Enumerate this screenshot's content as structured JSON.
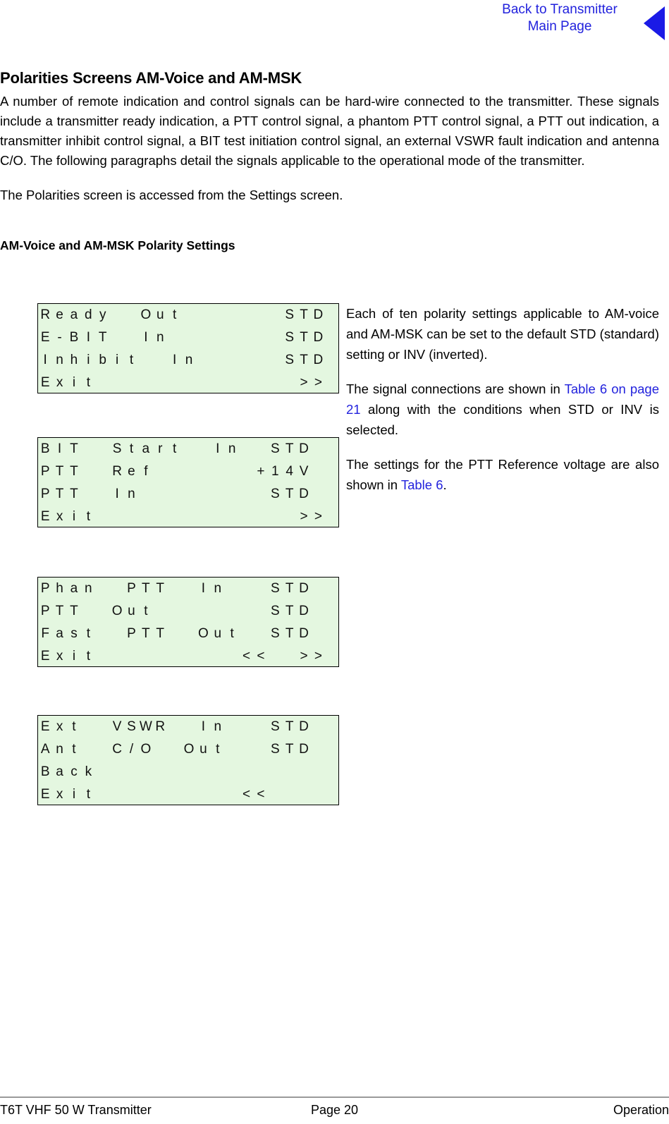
{
  "header": {
    "back_link_line1": "Back to Transmitter",
    "back_link_line2": "Main Page",
    "triangle_icon": "left-triangle-icon",
    "triangle_color": "#1a1ae6",
    "link_color": "#2222dd"
  },
  "section": {
    "title": "Polarities Screens AM-Voice and AM-MSK",
    "paragraph_1": "A number of remote indication and control signals can be hard-wire connected to the transmitter. These signals include a transmitter ready indication, a PTT control signal, a phantom PTT control signal, a PTT out indication, a transmitter inhibit control signal, a BIT test initiation control signal, an external VSWR fault indication and antenna C/O. The following paragraphs detail the signals applicable to the operational mode of the transmitter.",
    "paragraph_2": "The Polarities screen is accessed from the Settings screen.",
    "subtitle": "AM-Voice and AM-MSK Polarity Settings"
  },
  "lcd_screens": [
    {
      "name": "polarity-screen-1",
      "columns": 21,
      "background": "#e4f7e0",
      "rows": [
        {
          "cells": [
            {
              "col": 0,
              "ch": "R"
            },
            {
              "col": 1,
              "ch": "e"
            },
            {
              "col": 2,
              "ch": "a"
            },
            {
              "col": 3,
              "ch": "d"
            },
            {
              "col": 4,
              "ch": "y"
            },
            {
              "col": 7,
              "ch": "O"
            },
            {
              "col": 8,
              "ch": "u"
            },
            {
              "col": 9,
              "ch": "t"
            },
            {
              "col": 17,
              "ch": "S"
            },
            {
              "col": 18,
              "ch": "T"
            },
            {
              "col": 19,
              "ch": "D"
            }
          ],
          "text": "Ready   Out        STD"
        },
        {
          "cells": [
            {
              "col": 0,
              "ch": "E"
            },
            {
              "col": 1,
              "ch": "-"
            },
            {
              "col": 2,
              "ch": "B"
            },
            {
              "col": 3,
              "ch": "I"
            },
            {
              "col": 4,
              "ch": "T"
            },
            {
              "col": 7,
              "ch": "I"
            },
            {
              "col": 8,
              "ch": "n"
            },
            {
              "col": 17,
              "ch": "S"
            },
            {
              "col": 18,
              "ch": "T"
            },
            {
              "col": 19,
              "ch": "D"
            }
          ],
          "text": "E-BIT   In         STD"
        },
        {
          "cells": [
            {
              "col": 0,
              "ch": "I"
            },
            {
              "col": 1,
              "ch": "n"
            },
            {
              "col": 2,
              "ch": "h"
            },
            {
              "col": 3,
              "ch": "i"
            },
            {
              "col": 4,
              "ch": "b"
            },
            {
              "col": 5,
              "ch": "i"
            },
            {
              "col": 6,
              "ch": "t"
            },
            {
              "col": 9,
              "ch": "I"
            },
            {
              "col": 10,
              "ch": "n"
            },
            {
              "col": 17,
              "ch": "S"
            },
            {
              "col": 18,
              "ch": "T"
            },
            {
              "col": 19,
              "ch": "D"
            }
          ],
          "text": "Inhibit  In        STD"
        },
        {
          "cells": [
            {
              "col": 0,
              "ch": "E"
            },
            {
              "col": 1,
              "ch": "x"
            },
            {
              "col": 2,
              "ch": "i"
            },
            {
              "col": 3,
              "ch": "t"
            },
            {
              "col": 18,
              "ch": ">"
            },
            {
              "col": 19,
              "ch": ">"
            }
          ],
          "text": "Exit                >>"
        }
      ]
    },
    {
      "name": "polarity-screen-2",
      "columns": 21,
      "background": "#e4f7e0",
      "rows": [
        {
          "cells": [
            {
              "col": 0,
              "ch": "B"
            },
            {
              "col": 1,
              "ch": "I"
            },
            {
              "col": 2,
              "ch": "T"
            },
            {
              "col": 5,
              "ch": "S"
            },
            {
              "col": 6,
              "ch": "t"
            },
            {
              "col": 7,
              "ch": "a"
            },
            {
              "col": 8,
              "ch": "r"
            },
            {
              "col": 9,
              "ch": "t"
            },
            {
              "col": 12,
              "ch": "I"
            },
            {
              "col": 13,
              "ch": "n"
            },
            {
              "col": 16,
              "ch": "S"
            },
            {
              "col": 17,
              "ch": "T"
            },
            {
              "col": 18,
              "ch": "D"
            }
          ],
          "text": "BIT  Start  In  STD"
        },
        {
          "cells": [
            {
              "col": 0,
              "ch": "P"
            },
            {
              "col": 1,
              "ch": "T"
            },
            {
              "col": 2,
              "ch": "T"
            },
            {
              "col": 5,
              "ch": "R"
            },
            {
              "col": 6,
              "ch": "e"
            },
            {
              "col": 7,
              "ch": "f"
            },
            {
              "col": 15,
              "ch": "+"
            },
            {
              "col": 16,
              "ch": "1"
            },
            {
              "col": 17,
              "ch": "4"
            },
            {
              "col": 18,
              "ch": "V"
            }
          ],
          "text": "PTT  Ref        +14V"
        },
        {
          "cells": [
            {
              "col": 0,
              "ch": "P"
            },
            {
              "col": 1,
              "ch": "T"
            },
            {
              "col": 2,
              "ch": "T"
            },
            {
              "col": 5,
              "ch": "I"
            },
            {
              "col": 6,
              "ch": "n"
            },
            {
              "col": 16,
              "ch": "S"
            },
            {
              "col": 17,
              "ch": "T"
            },
            {
              "col": 18,
              "ch": "D"
            }
          ],
          "text": "PTT  In         STD"
        },
        {
          "cells": [
            {
              "col": 0,
              "ch": "E"
            },
            {
              "col": 1,
              "ch": "x"
            },
            {
              "col": 2,
              "ch": "i"
            },
            {
              "col": 3,
              "ch": "t"
            },
            {
              "col": 18,
              "ch": ">"
            },
            {
              "col": 19,
              "ch": ">"
            }
          ],
          "text": "Exit                >>"
        }
      ]
    },
    {
      "name": "polarity-screen-3",
      "columns": 21,
      "background": "#e4f7e0",
      "rows": [
        {
          "cells": [
            {
              "col": 0,
              "ch": "P"
            },
            {
              "col": 1,
              "ch": "h"
            },
            {
              "col": 2,
              "ch": "a"
            },
            {
              "col": 3,
              "ch": "n"
            },
            {
              "col": 6,
              "ch": "P"
            },
            {
              "col": 7,
              "ch": "T"
            },
            {
              "col": 8,
              "ch": "T"
            },
            {
              "col": 11,
              "ch": "I"
            },
            {
              "col": 12,
              "ch": "n"
            },
            {
              "col": 16,
              "ch": "S"
            },
            {
              "col": 17,
              "ch": "T"
            },
            {
              "col": 18,
              "ch": "D"
            }
          ],
          "text": "Phan  PTT  In   STD"
        },
        {
          "cells": [
            {
              "col": 0,
              "ch": "P"
            },
            {
              "col": 1,
              "ch": "T"
            },
            {
              "col": 2,
              "ch": "T"
            },
            {
              "col": 5,
              "ch": "O"
            },
            {
              "col": 6,
              "ch": "u"
            },
            {
              "col": 7,
              "ch": "t"
            },
            {
              "col": 16,
              "ch": "S"
            },
            {
              "col": 17,
              "ch": "T"
            },
            {
              "col": 18,
              "ch": "D"
            }
          ],
          "text": "PTT  Out        STD"
        },
        {
          "cells": [
            {
              "col": 0,
              "ch": "F"
            },
            {
              "col": 1,
              "ch": "a"
            },
            {
              "col": 2,
              "ch": "s"
            },
            {
              "col": 3,
              "ch": "t"
            },
            {
              "col": 6,
              "ch": "P"
            },
            {
              "col": 7,
              "ch": "T"
            },
            {
              "col": 8,
              "ch": "T"
            },
            {
              "col": 11,
              "ch": "O"
            },
            {
              "col": 12,
              "ch": "u"
            },
            {
              "col": 13,
              "ch": "t"
            },
            {
              "col": 16,
              "ch": "S"
            },
            {
              "col": 17,
              "ch": "T"
            },
            {
              "col": 18,
              "ch": "D"
            }
          ],
          "text": "Fast  PTT  Out  STD"
        },
        {
          "cells": [
            {
              "col": 0,
              "ch": "E"
            },
            {
              "col": 1,
              "ch": "x"
            },
            {
              "col": 2,
              "ch": "i"
            },
            {
              "col": 3,
              "ch": "t"
            },
            {
              "col": 14,
              "ch": "<"
            },
            {
              "col": 15,
              "ch": "<"
            },
            {
              "col": 18,
              "ch": ">"
            },
            {
              "col": 19,
              "ch": ">"
            }
          ],
          "text": "Exit          <<   >>"
        }
      ]
    },
    {
      "name": "polarity-screen-4",
      "columns": 21,
      "background": "#e4f7e0",
      "rows": [
        {
          "cells": [
            {
              "col": 0,
              "ch": "E"
            },
            {
              "col": 1,
              "ch": "x"
            },
            {
              "col": 2,
              "ch": "t"
            },
            {
              "col": 5,
              "ch": "V"
            },
            {
              "col": 6,
              "ch": "S"
            },
            {
              "col": 7,
              "ch": "W"
            },
            {
              "col": 8,
              "ch": "R"
            },
            {
              "col": 11,
              "ch": "I"
            },
            {
              "col": 12,
              "ch": "n"
            },
            {
              "col": 16,
              "ch": "S"
            },
            {
              "col": 17,
              "ch": "T"
            },
            {
              "col": 18,
              "ch": "D"
            }
          ],
          "text": "Ext  VSWR  In   STD"
        },
        {
          "cells": [
            {
              "col": 0,
              "ch": "A"
            },
            {
              "col": 1,
              "ch": "n"
            },
            {
              "col": 2,
              "ch": "t"
            },
            {
              "col": 5,
              "ch": "C"
            },
            {
              "col": 6,
              "ch": "/"
            },
            {
              "col": 7,
              "ch": "O"
            },
            {
              "col": 10,
              "ch": "O"
            },
            {
              "col": 11,
              "ch": "u"
            },
            {
              "col": 12,
              "ch": "t"
            },
            {
              "col": 16,
              "ch": "S"
            },
            {
              "col": 17,
              "ch": "T"
            },
            {
              "col": 18,
              "ch": "D"
            }
          ],
          "text": "Ant  C/O  Out   STD"
        },
        {
          "cells": [
            {
              "col": 0,
              "ch": "B"
            },
            {
              "col": 1,
              "ch": "a"
            },
            {
              "col": 2,
              "ch": "c"
            },
            {
              "col": 3,
              "ch": "k"
            }
          ],
          "text": "Back"
        },
        {
          "cells": [
            {
              "col": 0,
              "ch": "E"
            },
            {
              "col": 1,
              "ch": "x"
            },
            {
              "col": 2,
              "ch": "i"
            },
            {
              "col": 3,
              "ch": "t"
            },
            {
              "col": 14,
              "ch": "<"
            },
            {
              "col": 15,
              "ch": "<"
            }
          ],
          "text": "Exit          <<"
        }
      ]
    }
  ],
  "side_text": {
    "para_1": "Each of ten polarity settings applicable to AM-voice and AM-MSK can be set to the default STD (standard) setting or INV (inverted).",
    "para_2_pre": "The signal connections are shown in ",
    "para_2_link": "Table 6 on page 21",
    "para_2_post": " along with the conditions when STD or INV is selected.",
    "para_3_pre": "The settings for the PTT Reference voltage are also shown in ",
    "para_3_link": "Table 6",
    "para_3_post": "."
  },
  "footer": {
    "left": "T6T VHF 50 W Transmitter",
    "center": "Page 20",
    "right": "Operation"
  }
}
